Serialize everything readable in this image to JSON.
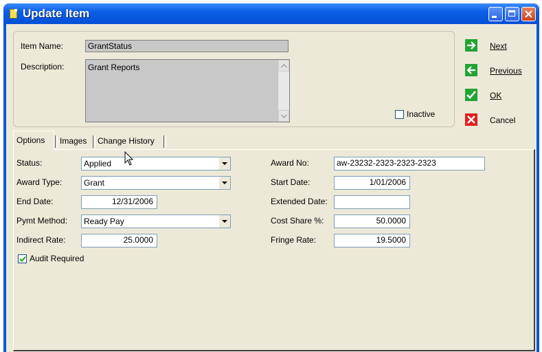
{
  "window": {
    "title": "Update Item"
  },
  "header": {
    "item_name_label": "Item Name:",
    "item_name_value": "GrantStatus",
    "description_label": "Description:",
    "description_value": "Grant Reports",
    "inactive_label": "Inactive",
    "inactive_checked": false
  },
  "actions": {
    "next": "Next",
    "previous": "Previous",
    "ok": "OK",
    "cancel": "Cancel"
  },
  "tabs": [
    "Options",
    "Images",
    "Change History"
  ],
  "active_tab": "Options",
  "options": {
    "status_label": "Status:",
    "status_value": "Applied",
    "award_type_label": "Award Type:",
    "award_type_value": "Grant",
    "end_date_label": "End Date:",
    "end_date_value": "12/31/2006",
    "pymt_method_label": "Pymt Method:",
    "pymt_method_value": "Ready Pay",
    "indirect_rate_label": "Indirect Rate:",
    "indirect_rate_value": "25.0000",
    "audit_required_label": "Audit Required",
    "audit_required_checked": true,
    "award_no_label": "Award No:",
    "award_no_value": "aw-23232-2323-2323-2323",
    "start_date_label": "Start Date:",
    "start_date_value": "1/01/2006",
    "extended_date_label": "Extended Date:",
    "extended_date_value": "",
    "cost_share_label": "Cost Share %:",
    "cost_share_value": "50.0000",
    "fringe_rate_label": "Fringe Rate:",
    "fringe_rate_value": "19.5000"
  },
  "colors": {
    "title_bar": "#0A5FE6",
    "client_bg": "#ECE9D8",
    "next_green": "#22a334",
    "cancel_red": "#e02020"
  }
}
